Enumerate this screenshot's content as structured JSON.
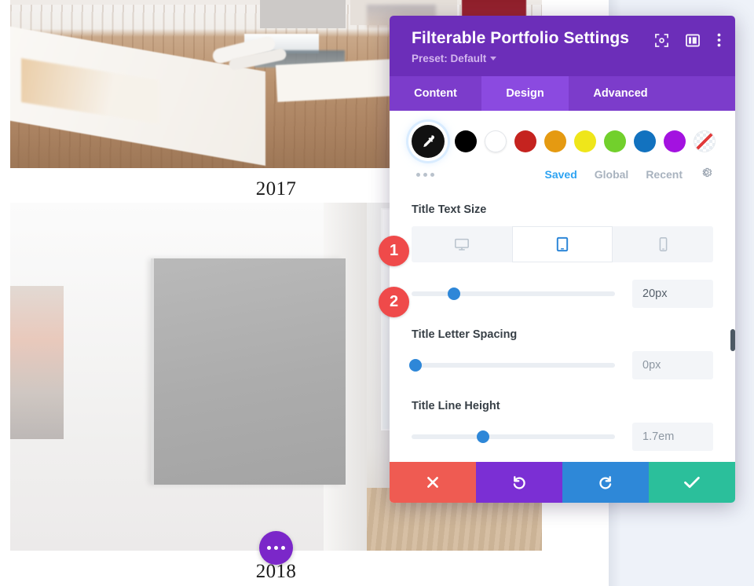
{
  "page": {
    "portfolio_items": [
      {
        "caption": "2017",
        "image_name": "art-studio-floor-photo"
      },
      {
        "caption": "2018",
        "image_name": "gallery-wall-canvas-photo"
      }
    ],
    "fab_label": "more-options"
  },
  "modal": {
    "title": "Filterable Portfolio Settings",
    "preset_label": "Preset: Default",
    "header_icons": [
      {
        "name": "focus-target-icon"
      },
      {
        "name": "panel-layout-icon"
      },
      {
        "name": "more-vertical-icon"
      }
    ],
    "tabs": [
      {
        "label": "Content",
        "active": false
      },
      {
        "label": "Design",
        "active": true
      },
      {
        "label": "Advanced",
        "active": false
      }
    ],
    "color_picker": {
      "eyedropper_name": "eyedropper-icon",
      "swatches": [
        {
          "name": "black",
          "hex": "#000000"
        },
        {
          "name": "white",
          "hex": "#ffffff"
        },
        {
          "name": "red",
          "hex": "#c5231f"
        },
        {
          "name": "orange",
          "hex": "#e59a11"
        },
        {
          "name": "yellow",
          "hex": "#efe61a"
        },
        {
          "name": "green",
          "hex": "#72d02c"
        },
        {
          "name": "blue",
          "hex": "#1272bf"
        },
        {
          "name": "purple",
          "hex": "#a312e0"
        },
        {
          "name": "none",
          "hex": "transparent"
        }
      ],
      "more_label": "more-swatches",
      "links": [
        {
          "label": "Saved",
          "active": true
        },
        {
          "label": "Global",
          "active": false
        },
        {
          "label": "Recent",
          "active": false
        }
      ],
      "settings_icon": "gear-icon"
    },
    "fields": [
      {
        "label": "Title Text Size",
        "devices": [
          {
            "name": "desktop",
            "active": false
          },
          {
            "name": "tablet",
            "active": true
          },
          {
            "name": "phone",
            "active": false
          }
        ],
        "value": "20px",
        "slider_percent": 21
      },
      {
        "label": "Title Letter Spacing",
        "value": "0px",
        "slider_percent": 2
      },
      {
        "label": "Title Line Height",
        "value": "1.7em",
        "slider_percent": 35
      }
    ],
    "footer_buttons": [
      {
        "name": "close",
        "icon": "close-x-icon",
        "color": "#ef5b52"
      },
      {
        "name": "undo",
        "icon": "undo-arrow-icon",
        "color": "#7b2fd4"
      },
      {
        "name": "redo",
        "icon": "redo-arrow-icon",
        "color": "#2e88d8"
      },
      {
        "name": "save",
        "icon": "checkmark-icon",
        "color": "#2bbf9b"
      }
    ]
  },
  "callouts": [
    {
      "number": "1"
    },
    {
      "number": "2"
    }
  ]
}
